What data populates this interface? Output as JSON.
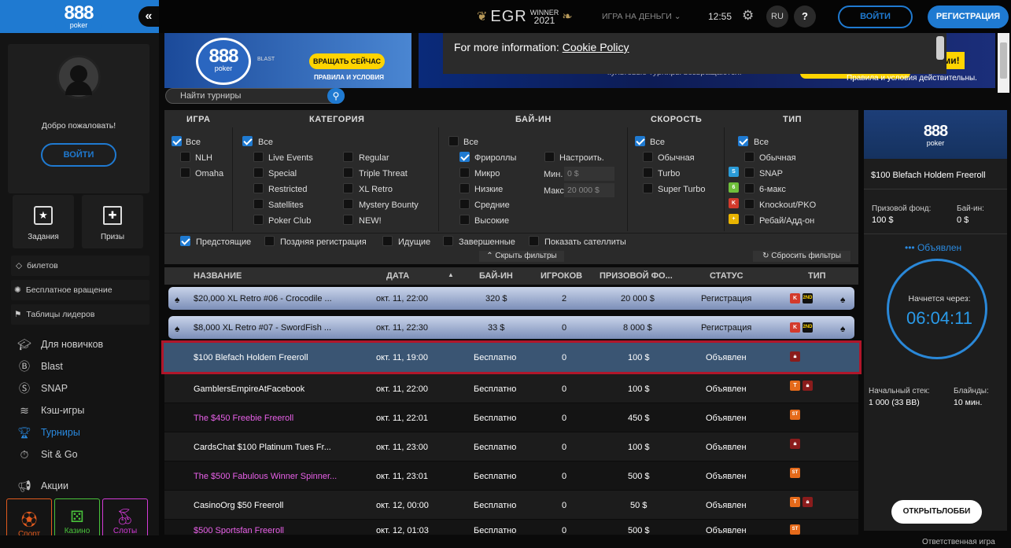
{
  "brand": {
    "logo": "888",
    "sub": "poker"
  },
  "topbar": {
    "egr": "EGR",
    "winner": "WINNER",
    "year": "2021",
    "mode": "ИГРА НА ДЕНЬГИ",
    "time": "12:55",
    "lang": "RU",
    "help": "?",
    "login": "ВОЙТИ",
    "register": "РЕГИСТРАЦИЯ"
  },
  "sidebar": {
    "welcome": "Добро пожаловать!",
    "login": "ВОЙТИ",
    "tasks": "Задания",
    "prizes": "Призы",
    "links": [
      "билетов",
      "Бесплатное вращение",
      "Таблицы лидеров"
    ],
    "nav": [
      "Для новичков",
      "Blast",
      "SNAP",
      "Кэш-игры",
      "Турниры",
      "Sit & Go",
      "Акции"
    ],
    "tiles": [
      "Спорт",
      "Казино",
      "Слоты"
    ]
  },
  "banners": {
    "spin": "ВРАЩАТЬ СЕЙЧАС",
    "terms": "ПРАВИЛА И УСЛОВИЯ",
    "blast": "BLAST",
    "right_text": "культовые турниры возвращаются!",
    "right_terms": "Правила и условия действительны.",
    "right_badge": "олами!"
  },
  "cookie": {
    "text": "For more information:",
    "link": "Cookie Policy"
  },
  "search": {
    "placeholder": "Найти турниры"
  },
  "filters": {
    "headers": [
      "ИГРА",
      "КАТЕГОРИЯ",
      "БАЙ-ИН",
      "СКОРОСТЬ",
      "ТИП"
    ],
    "game": [
      "Все",
      "NLH",
      "Omaha"
    ],
    "category_all": "Все",
    "category_left": [
      "Live Events",
      "Special",
      "Restricted",
      "Satellites",
      "Poker Club"
    ],
    "category_right": [
      "Regular",
      "Triple Threat",
      "XL Retro",
      "Mystery Bounty",
      "NEW!"
    ],
    "buyin": [
      "Все",
      "Фрироллы",
      "Микро",
      "Низкие",
      "Средние",
      "Высокие"
    ],
    "custom": "Настроить.",
    "min_label": "Мин.",
    "min_val": "0 $",
    "max_label": "Макс.",
    "max_val": "20 000 $",
    "speed": [
      "Все",
      "Обычная",
      "Turbo",
      "Super Turbo"
    ],
    "type": [
      "Все",
      "Обычная",
      "SNAP",
      "6-макс",
      "Knockout/PKO",
      "Ребай/Адд-он"
    ],
    "bottom": [
      "Предстоящие",
      "Поздняя регистрация",
      "Идущие",
      "Завершенные",
      "Показать сателлиты"
    ],
    "hide": "Скрыть фильтры",
    "reset": "Сбросить фильтры"
  },
  "table": {
    "headers": [
      "НАЗВАНИЕ",
      "ДАТА",
      "БАЙ-ИН",
      "ИГРОКОВ",
      "ПРИЗОВОЙ ФО...",
      "СТАТУС",
      "ТИП"
    ],
    "rows": [
      {
        "name": "$20,000 XL Retro #06 - Crocodile ...",
        "date": "окт. 11, 22:00",
        "buyin": "320 $",
        "players": "2",
        "prize": "20 000 $",
        "status": "Регистрация"
      },
      {
        "name": "$8,000 XL Retro #07 - SwordFish ...",
        "date": "окт. 11, 22:30",
        "buyin": "33 $",
        "players": "0",
        "prize": "8 000 $",
        "status": "Регистрация"
      },
      {
        "name": "$100 Blefach Holdem Freeroll",
        "date": "окт. 11, 19:00",
        "buyin": "Бесплатно",
        "players": "0",
        "prize": "100 $",
        "status": "Объявлен"
      },
      {
        "name": "GamblersEmpireAtFacebook",
        "date": "окт. 11, 22:00",
        "buyin": "Бесплатно",
        "players": "0",
        "prize": "100 $",
        "status": "Объявлен"
      },
      {
        "name": "The $450 Freebie Freeroll",
        "date": "окт. 11, 22:01",
        "buyin": "Бесплатно",
        "players": "0",
        "prize": "450 $",
        "status": "Объявлен"
      },
      {
        "name": "CardsChat $100 Platinum Tues Fr...",
        "date": "окт. 11, 23:00",
        "buyin": "Бесплатно",
        "players": "0",
        "prize": "100 $",
        "status": "Объявлен"
      },
      {
        "name": "The $500 Fabulous Winner Spinner...",
        "date": "окт. 11, 23:01",
        "buyin": "Бесплатно",
        "players": "0",
        "prize": "500 $",
        "status": "Объявлен"
      },
      {
        "name": "CasinoOrg $50 Freeroll",
        "date": "окт. 12, 00:00",
        "buyin": "Бесплатно",
        "players": "0",
        "prize": "50 $",
        "status": "Объявлен"
      },
      {
        "name": "$500 Sportsfan Freeroll",
        "date": "окт. 12, 01:03",
        "buyin": "Бесплатно",
        "players": "0",
        "prize": "500 $",
        "status": "Объявлен"
      }
    ]
  },
  "panel": {
    "title": "$100 Blefach Holdem Freeroll",
    "prize_label": "Призовой фонд:",
    "prize": "100 $",
    "buyin_label": "Бай-ин:",
    "buyin": "0 $",
    "status": "••• Объявлен",
    "starts_label": "Начнется через:",
    "countdown": "06:04:11",
    "stack_label": "Начальный стек:",
    "stack": "1 000 (33 BB)",
    "blinds_label": "Блайнды:",
    "blinds": "10 мин.",
    "open": "ОТКРЫТЬЛОББИ"
  },
  "footer": "Ответственная игра"
}
